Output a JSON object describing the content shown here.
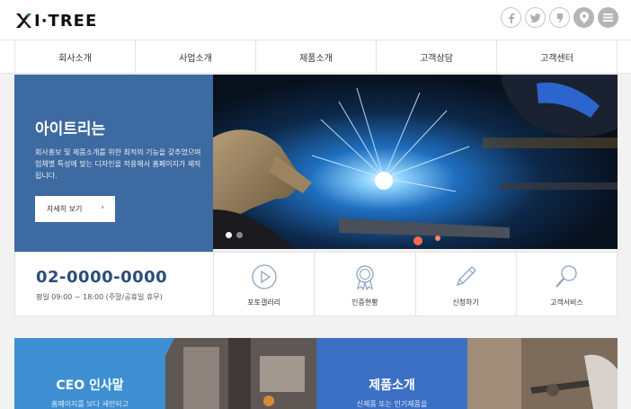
{
  "brand": {
    "logo_text": "I·TREE"
  },
  "social": [
    "facebook-icon",
    "twitter-icon",
    "kakao-icon",
    "location-icon",
    "menu-icon"
  ],
  "nav": {
    "items": [
      "회사소개",
      "사업소개",
      "제품소개",
      "고객상담",
      "고객센터"
    ]
  },
  "hero": {
    "title": "아이트리는",
    "description": "회사홍보 및 제품소개를 위한 최적의 기능을 갖추었으며 업체별 특성에 맞는 디자인을 적용해서 홈페이지가 제작됩니다.",
    "more_label": "자세히 보기",
    "slides_count": 2,
    "active_slide": 1
  },
  "contact": {
    "phone": "02-0000-0000",
    "hours": "평일 09:00 ~ 18:00 (주말/공휴일 휴무)"
  },
  "quick_links": [
    {
      "label": "포토갤러리",
      "icon": "play-icon"
    },
    {
      "label": "인증현황",
      "icon": "medal-icon"
    },
    {
      "label": "신청하기",
      "icon": "pencil-icon"
    },
    {
      "label": "고객서비스",
      "icon": "search-icon"
    }
  ],
  "promos": {
    "ceo": {
      "title": "CEO 인사말",
      "subtitle": "홈페이지를 보다 세련되고"
    },
    "products": {
      "title": "제품소개",
      "subtitle": "신제품 또는 인기제품을"
    }
  },
  "colors": {
    "primary": "#3d6aa0",
    "phone_text": "#2a4d7d",
    "ceo_bg": "#3d8fd1",
    "products_bg": "#3b6fc4"
  }
}
